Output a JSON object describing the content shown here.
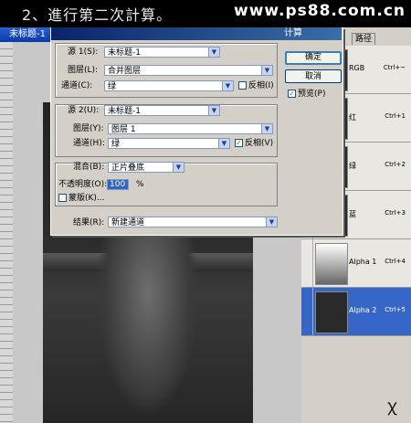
{
  "banner": {
    "step": "2、進行第二次計算。",
    "site": "www.ps88.com.cn"
  },
  "document": {
    "title": "未标题-1"
  },
  "dialog": {
    "title": "计算",
    "source1": {
      "label": "源 1(S):",
      "file": "未标题-1",
      "layer_label": "图层(L):",
      "layer": "合并图层",
      "channel_label": "通道(C):",
      "channel": "绿",
      "invert_label": "反相(I)",
      "invert_checked": false
    },
    "source2": {
      "label": "源 2(U):",
      "file": "未标题-1",
      "layer_label": "图层(Y):",
      "layer": "图层 1",
      "channel_label": "通道(H):",
      "channel": "绿",
      "invert_label": "反相(V)",
      "invert_checked": true
    },
    "blend": {
      "label": "混合(B):",
      "mode": "正片叠底",
      "opacity_label": "不透明度(O):",
      "opacity": "100",
      "unit": "%",
      "mask_label": "蒙版(K)...",
      "mask_checked": false
    },
    "result": {
      "label": "结果(R):",
      "value": "新建通道"
    },
    "ok_label": "确定",
    "cancel_label": "取消",
    "preview_label": "预览(P)",
    "preview_checked": true
  },
  "channels_panel": {
    "tab_label": "路径",
    "rows": [
      {
        "name": "RGB",
        "shortcut": "Ctrl+~",
        "selected": false
      },
      {
        "name": "红",
        "shortcut": "Ctrl+1",
        "selected": false
      },
      {
        "name": "绿",
        "shortcut": "Ctrl+2",
        "selected": false
      },
      {
        "name": "蓝",
        "shortcut": "Ctrl+3",
        "selected": false
      },
      {
        "name": "Alpha 1",
        "shortcut": "Ctrl+4",
        "selected": false
      },
      {
        "name": "Alpha 2",
        "shortcut": "Ctrl+5",
        "selected": true
      }
    ]
  },
  "colors": {
    "titlebar": "#0a246a",
    "selection": "#3166c5"
  }
}
